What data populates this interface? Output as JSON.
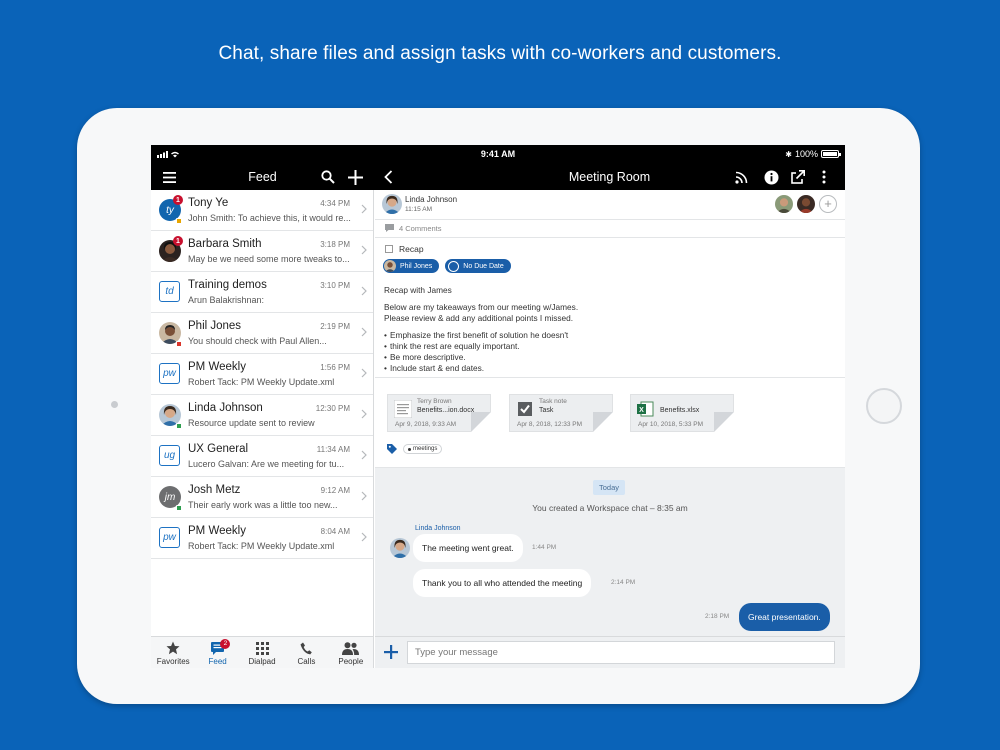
{
  "headline": "Chat, share files and assign tasks with co-workers and customers.",
  "status": {
    "time": "9:41 AM",
    "battery": "100%"
  },
  "left_nav": {
    "title": "Feed"
  },
  "right_nav": {
    "title": "Meeting Room"
  },
  "feed": [
    {
      "name": "Tony Ye",
      "time": "4:34 PM",
      "preview": "John Smith: To achieve this, it would re...",
      "avatar": "ty",
      "avatar_style": "blue",
      "badge": "1"
    },
    {
      "name": "Barbara Smith",
      "time": "3:18 PM",
      "preview": "May be we need some more tweaks to...",
      "avatar": "",
      "avatar_style": "photo",
      "badge": "1"
    },
    {
      "name": "Training demos",
      "time": "3:10 PM",
      "preview": "Arun Balakrishnan:",
      "avatar": "td",
      "avatar_style": "outline",
      "badge": ""
    },
    {
      "name": "Phil Jones",
      "time": "2:19 PM",
      "preview": "You should check with Paul Allen...",
      "avatar": "",
      "avatar_style": "photo",
      "badge": ""
    },
    {
      "name": "PM Weekly",
      "time": "1:56 PM",
      "preview": "Robert Tack:  PM Weekly Update.xml",
      "avatar": "pw",
      "avatar_style": "outline",
      "badge": ""
    },
    {
      "name": "Linda Johnson",
      "time": "12:30 PM",
      "preview": "Resource update sent to review",
      "avatar": "",
      "avatar_style": "photo",
      "badge": ""
    },
    {
      "name": "UX General",
      "time": "11:34 AM",
      "preview": "Lucero Galvan: Are we meeting for tu...",
      "avatar": "ug",
      "avatar_style": "outline",
      "badge": ""
    },
    {
      "name": "Josh Metz",
      "time": "9:12 AM",
      "preview": "Their early work was a little too new...",
      "avatar": "jm",
      "avatar_style": "gray",
      "badge": ""
    },
    {
      "name": "PM Weekly",
      "time": "8:04 AM",
      "preview": "Robert Tack:  PM Weekly Update.xml",
      "avatar": "pw",
      "avatar_style": "outline",
      "badge": ""
    }
  ],
  "tabs": [
    {
      "label": "Favorites",
      "icon": "star-icon"
    },
    {
      "label": "Feed",
      "icon": "feed-icon",
      "badge": "2"
    },
    {
      "label": "Dialpad",
      "icon": "dialpad-icon"
    },
    {
      "label": "Calls",
      "icon": "phone-icon"
    },
    {
      "label": "People",
      "icon": "people-icon"
    }
  ],
  "post": {
    "author": "Linda Johnson",
    "time": "11:15 AM",
    "comments": "4 Comments"
  },
  "task": {
    "title": "Recap",
    "assignee": "Phil Jones",
    "due": "No Due Date",
    "intro": "Recap with James",
    "body1": "Below are my takeaways from our meeting w/James.",
    "body2": "Please review & add any additional points I missed.",
    "bullets": [
      "Emphasize the first benefit of solution he doesn't",
      "think the rest are equally important.",
      "Be more descriptive.",
      "Include start & end dates."
    ]
  },
  "files": [
    {
      "top": "Terry Brown",
      "name": "Benefits...ion.docx",
      "date": "Apr 9, 2018, 9:33 AM"
    },
    {
      "top": "Task note",
      "name": "Task",
      "date": "Apr 8, 2018, 12:33 PM"
    },
    {
      "top": "",
      "name": "Benefits.xlsx",
      "date": "Apr 10, 2018, 5:33 PM"
    }
  ],
  "tag": "meetings",
  "chat": {
    "today": "Today",
    "system": "You created a Workspace chat – 8:35 am",
    "sender": "Linda Johnson",
    "messages": [
      {
        "text": "The meeting went great.",
        "time": "1:44 PM"
      },
      {
        "text": "Thank you to all who attended the meeting",
        "time": "2:14 PM"
      },
      {
        "text": "Great presentation.",
        "time": "2:18 PM"
      }
    ]
  },
  "composer": {
    "placeholder": "Type your message"
  },
  "colors": {
    "background": "#0a63b8",
    "accent": "#1a5ea8",
    "badge": "#c8102e"
  }
}
